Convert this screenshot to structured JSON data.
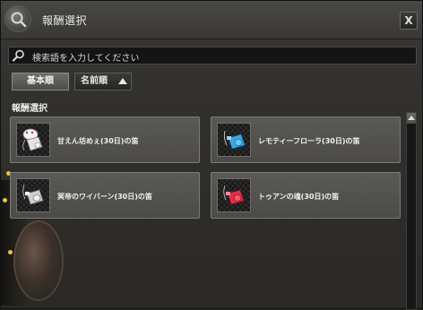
{
  "window": {
    "title": "報酬選択",
    "close_label": "X"
  },
  "search": {
    "placeholder": "検索語を入力してください"
  },
  "sort": {
    "basic_label": "基本順",
    "name_label": "名前順"
  },
  "section": {
    "label": "報酬選択"
  },
  "rewards": [
    {
      "name": "甘えん坊めぇ(30日)の笛",
      "icon": "white-sheep-whistle-icon",
      "color": "#e8e8e8"
    },
    {
      "name": "レモティーフローラ(30日)の笛",
      "icon": "blue-whistle-icon",
      "color": "#3aa6e8"
    },
    {
      "name": "冥帝のワイバーン(30日)の笛",
      "icon": "silver-whistle-icon",
      "color": "#c8c8c8"
    },
    {
      "name": "トゥアンの魂(30日)の笛",
      "icon": "red-whistle-icon",
      "color": "#e0304a"
    }
  ]
}
